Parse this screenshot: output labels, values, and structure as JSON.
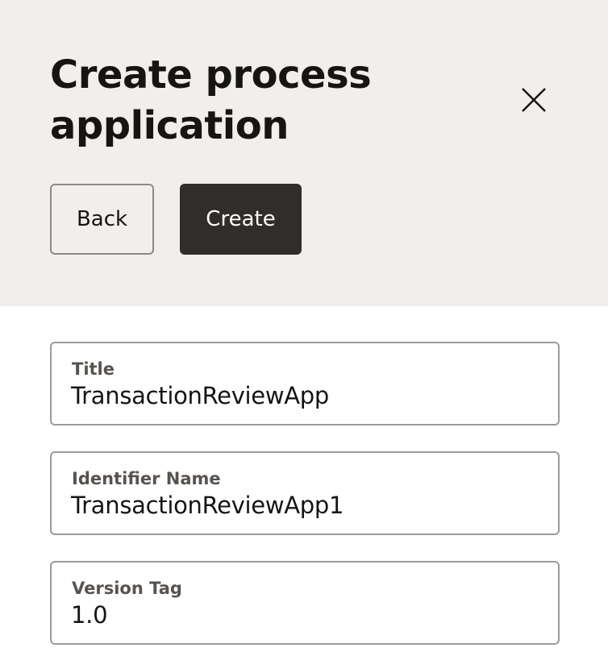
{
  "dialog": {
    "title": "Create process application",
    "close_icon": "close-icon",
    "back_label": "Back",
    "create_label": "Create"
  },
  "form": {
    "fields": [
      {
        "label": "Title",
        "value": "TransactionReviewApp"
      },
      {
        "label": "Identifier Name",
        "value": "TransactionReviewApp1"
      },
      {
        "label": "Version Tag",
        "value": "1.0"
      }
    ]
  },
  "colors": {
    "header_bg": "#f1efed",
    "primary_button_bg": "#312d2a",
    "text": "#161513",
    "label_text": "#57534f",
    "border": "#9e9a96"
  }
}
